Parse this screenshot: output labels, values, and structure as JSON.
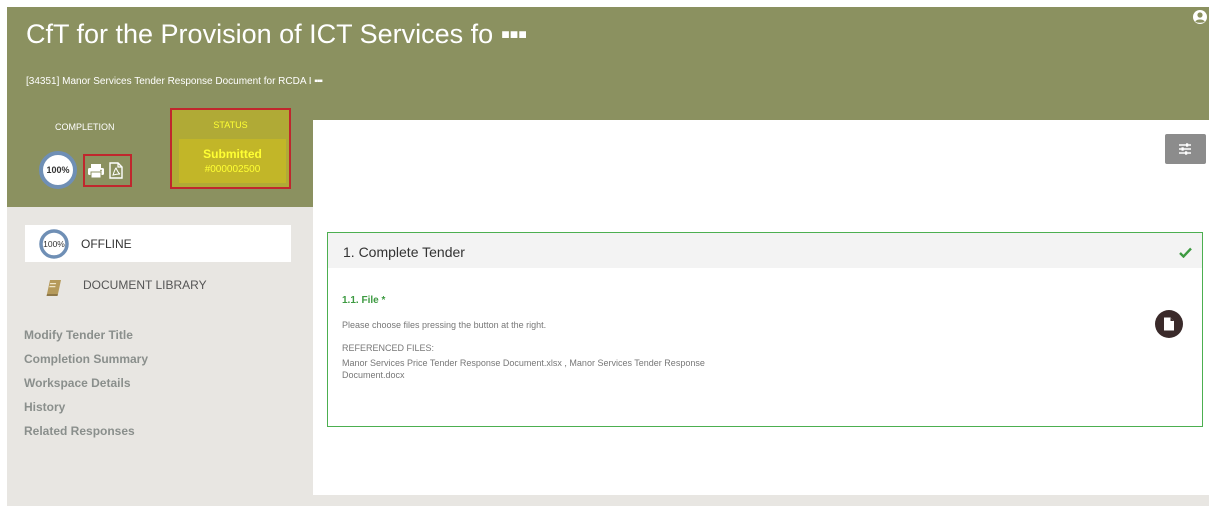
{
  "header": {
    "title": "CfT for the Provision of ICT Services fo",
    "title_ellipsis": "▪▪▪",
    "subtitle": "[34351] Manor Services Tender Response Document for RCDA I",
    "subtitle_ellipsis": "▪▪▪"
  },
  "completion": {
    "label": "COMPLETION",
    "percent_text": "100%",
    "percent_value": 100
  },
  "status": {
    "label": "STATUS",
    "value": "Submitted",
    "number": "#000002500"
  },
  "sidebar": {
    "offline": {
      "percent_text": "100%",
      "label": "OFFLINE"
    },
    "document_library": {
      "label": "DOCUMENT LIBRARY"
    },
    "links": [
      "Modify Tender Title",
      "Completion Summary",
      "Workspace Details",
      "History",
      "Related Responses"
    ]
  },
  "section": {
    "title": "1. Complete Tender",
    "field_title": "1.1. File",
    "required_mark": "*",
    "help_text": "Please choose files pressing the button at the right.",
    "referenced_label": "REFERENCED FILES:",
    "referenced_files": "Manor Services Price Tender Response Document.xlsx , Manor Services Tender Response Document.docx"
  },
  "icons": {
    "user": "user-circle-icon",
    "print": "print-icon",
    "pdf": "pdf-icon",
    "document_library": "book-icon",
    "settings": "sliders-icon",
    "check": "check-icon",
    "file": "file-icon"
  },
  "colors": {
    "header_bg": "#8b9160",
    "status_highlight": "#c2b628",
    "status_text": "#ffff33",
    "annotation_border": "#c0272d",
    "section_border": "#4caf50",
    "field_green": "#3d9a41",
    "ring_blue": "#6f8fb5"
  }
}
